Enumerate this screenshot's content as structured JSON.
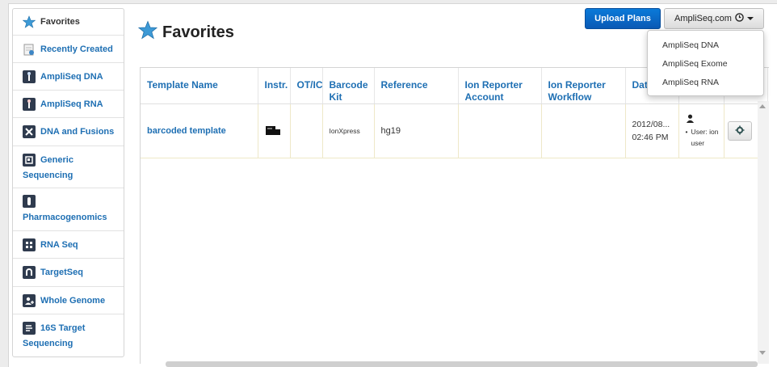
{
  "sidebar": {
    "items": [
      {
        "label": "Favorites",
        "icon": "star-icon"
      },
      {
        "label": "Recently Created",
        "icon": "calendar-icon"
      },
      {
        "label": "AmpliSeq DNA",
        "icon": "ampliseq-dna-icon"
      },
      {
        "label": "AmpliSeq RNA",
        "icon": "ampliseq-rna-icon"
      },
      {
        "label": "DNA and Fusions",
        "icon": "dna-fusions-icon"
      },
      {
        "label": "Generic Sequencing",
        "icon": "generic-sequencing-icon"
      },
      {
        "label": "Pharmacogenomics",
        "icon": "pharmacogenomics-icon"
      },
      {
        "label": "RNA Seq",
        "icon": "rna-seq-icon"
      },
      {
        "label": "TargetSeq",
        "icon": "targetseq-icon"
      },
      {
        "label": "Whole Genome",
        "icon": "whole-genome-icon"
      },
      {
        "label": "16S Target Sequencing",
        "icon": "16s-target-icon"
      }
    ]
  },
  "header": {
    "title": "Favorites",
    "upload_label": "Upload Plans",
    "dropdown_label": "AmpliSeq.com",
    "dropdown_items": [
      "AmpliSeq DNA",
      "AmpliSeq Exome",
      "AmpliSeq RNA"
    ]
  },
  "table": {
    "headers": [
      "Template Name",
      "Instr.",
      "OT/IC",
      "Barcode Kit",
      "Reference",
      "Ion Reporter Account",
      "Ion Reporter Workflow",
      "Dat"
    ],
    "rows": [
      {
        "name": "barcoded template",
        "instrument_icon": "pgm-instrument-icon",
        "otic": "",
        "barcode_kit": "IonXpress",
        "reference": "hg19",
        "ir_account": "",
        "ir_workflow": "",
        "date_line1": "2012/08...",
        "date_line2": "02:46 PM",
        "owner": "User: ion user"
      }
    ]
  },
  "colors": {
    "link": "#1e6fb3",
    "primary_button": "#0a6bc8",
    "row_border": "#eee8c8",
    "star": "#3d9ad6"
  }
}
